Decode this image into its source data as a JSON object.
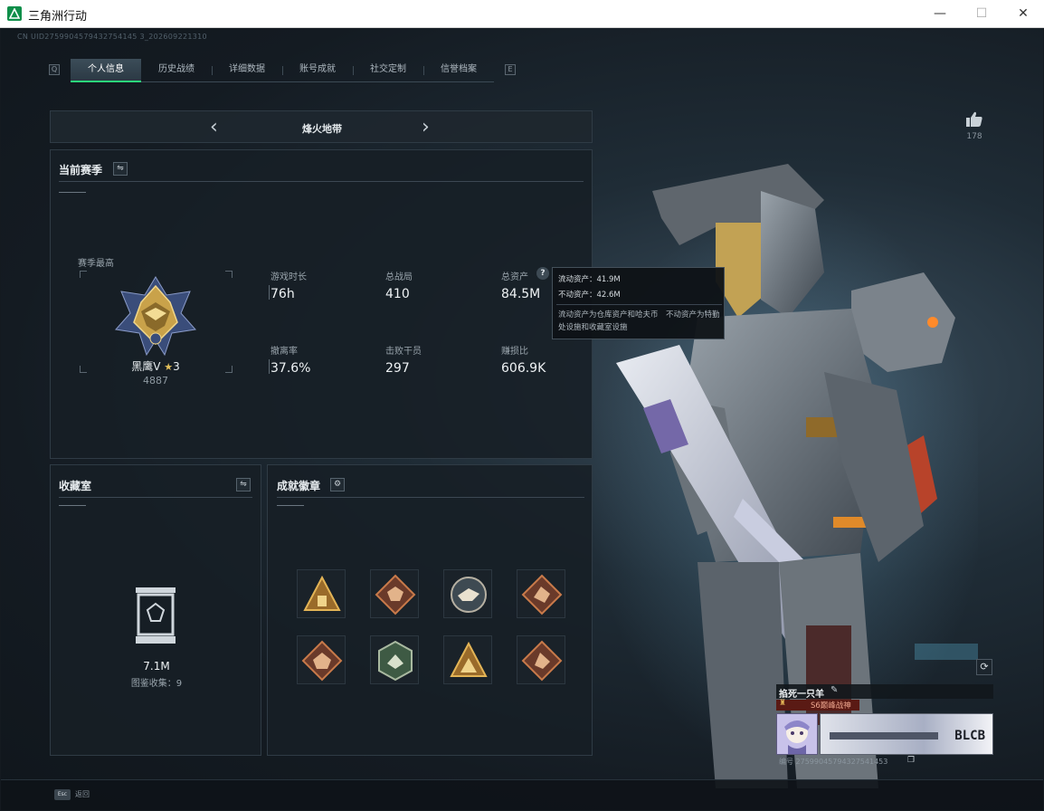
{
  "window": {
    "title": "三角洲行动",
    "min_glyph": "—",
    "max_glyph": "☐",
    "close_glyph": "✕"
  },
  "uid": "CN UID2759904579432754145 3_202609221310",
  "tabs": [
    {
      "label": "个人信息",
      "active": true
    },
    {
      "label": "历史战绩",
      "active": false
    },
    {
      "label": "详细数据",
      "active": false
    },
    {
      "label": "账号成就",
      "active": false
    },
    {
      "label": "社交定制",
      "active": false
    },
    {
      "label": "信誉档案",
      "active": false
    }
  ],
  "nav": {
    "prev_key": "Q",
    "next_key": "E"
  },
  "mode_selector": {
    "label": "烽火地带",
    "prev_glyph": "‹",
    "next_glyph": "›"
  },
  "likes": {
    "count": "178"
  },
  "season": {
    "title": "当前赛季",
    "highest_label": "赛季最高",
    "rank_name": "黑鹰V",
    "rank_stars": "3",
    "rank_score": "4887",
    "stats": [
      {
        "label": "游戏时长",
        "value": "76h"
      },
      {
        "label": "总战局",
        "value": "410"
      },
      {
        "label": "总资产",
        "value": "84.5M"
      },
      {
        "label": "撤离率",
        "value": "37.6%"
      },
      {
        "label": "击败干员",
        "value": "297"
      },
      {
        "label": "赚损比",
        "value": "606.9K"
      }
    ]
  },
  "tooltip": {
    "liquid": "流动资产：41.9M",
    "fixed": "不动资产：42.6M",
    "note": "流动资产为仓库资产和哈夫币　不动资产为特勤处设施和收藏室设施"
  },
  "collection": {
    "title": "收藏室",
    "value": "7.1M",
    "count_label": "图鉴收集：9"
  },
  "achievements": {
    "title": "成就徽章",
    "badges": [
      "badge-1",
      "badge-2",
      "badge-3",
      "badge-4",
      "badge-5",
      "badge-6",
      "badge-7",
      "badge-8"
    ]
  },
  "player": {
    "name": "掐死一只羊",
    "title_tag": "S6巅峰战神",
    "id_line": "编号 27599045794327541453",
    "banner_text": "BLCB"
  },
  "footer": {
    "key": "Esc",
    "label": "返回"
  },
  "colors": {
    "accent": "#2bd67b",
    "panel": "#171f26",
    "gold": "#c9a24a"
  }
}
